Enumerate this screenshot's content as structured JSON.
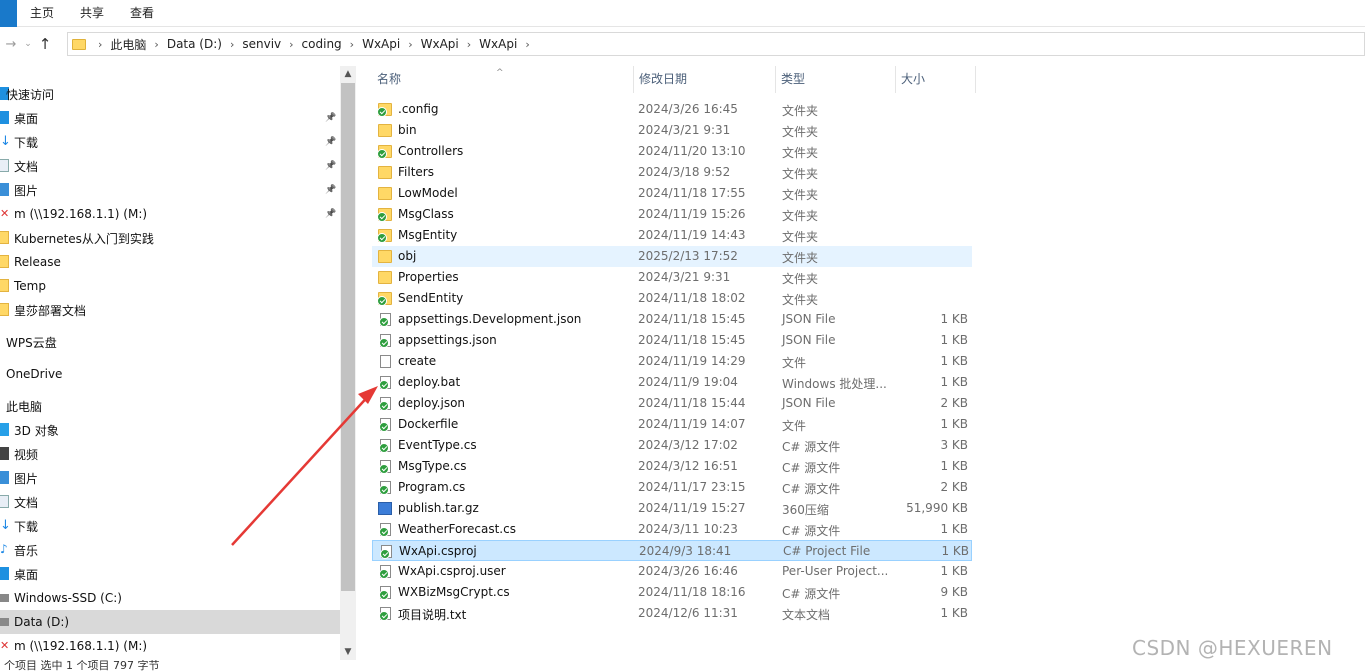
{
  "ribbon": {
    "tabs": [
      "主页",
      "共享",
      "查看"
    ]
  },
  "address": {
    "crumbs": [
      "此电脑",
      "Data (D:)",
      "senviv",
      "coding",
      "WxApi",
      "WxApi",
      "WxApi"
    ]
  },
  "sidebar": {
    "items": [
      {
        "label": "快速访问",
        "icon": "star-icon",
        "top": true
      },
      {
        "label": "桌面",
        "icon": "desktop-icon",
        "pin": true
      },
      {
        "label": "下载",
        "icon": "download-icon",
        "pin": true
      },
      {
        "label": "文档",
        "icon": "document-icon",
        "pin": true
      },
      {
        "label": "图片",
        "icon": "picture-icon",
        "pin": true
      },
      {
        "label": "m (\\\\192.168.1.1) (M:)",
        "icon": "network-drive-icon",
        "pin": true
      },
      {
        "label": "Kubernetes从入门到实践",
        "icon": "folder-icon"
      },
      {
        "label": "Release",
        "icon": "folder-icon"
      },
      {
        "label": "Temp",
        "icon": "folder-icon"
      },
      {
        "label": "皇莎部署文档",
        "icon": "folder-icon"
      },
      {
        "label": "WPS云盘",
        "icon": "cloud-icon",
        "top": true
      },
      {
        "label": "OneDrive",
        "icon": "onedrive-icon",
        "top": true
      },
      {
        "label": "此电脑",
        "icon": "pc-icon",
        "top": true
      },
      {
        "label": "3D 对象",
        "icon": "cube-icon"
      },
      {
        "label": "视频",
        "icon": "video-icon"
      },
      {
        "label": "图片",
        "icon": "picture-icon"
      },
      {
        "label": "文档",
        "icon": "document-icon"
      },
      {
        "label": "下载",
        "icon": "download-icon"
      },
      {
        "label": "音乐",
        "icon": "music-icon"
      },
      {
        "label": "桌面",
        "icon": "desktop-icon"
      },
      {
        "label": "Windows-SSD (C:)",
        "icon": "drive-icon"
      },
      {
        "label": "Data (D:)",
        "icon": "drive-icon",
        "state": "hover"
      },
      {
        "label": "m (\\\\192.168.1.1) (M:)",
        "icon": "network-drive-icon"
      }
    ]
  },
  "columns": {
    "name": "名称",
    "date": "修改日期",
    "type": "类型",
    "size": "大小"
  },
  "files": [
    {
      "name": ".config",
      "date": "2024/3/26 16:45",
      "type": "文件夹",
      "size": "",
      "kind": "folder",
      "sync": true
    },
    {
      "name": "bin",
      "date": "2024/3/21 9:31",
      "type": "文件夹",
      "size": "",
      "kind": "folder",
      "sync": false
    },
    {
      "name": "Controllers",
      "date": "2024/11/20 13:10",
      "type": "文件夹",
      "size": "",
      "kind": "folder",
      "sync": true
    },
    {
      "name": "Filters",
      "date": "2024/3/18 9:52",
      "type": "文件夹",
      "size": "",
      "kind": "folder",
      "sync": false
    },
    {
      "name": "LowModel",
      "date": "2024/11/18 17:55",
      "type": "文件夹",
      "size": "",
      "kind": "folder",
      "sync": false
    },
    {
      "name": "MsgClass",
      "date": "2024/11/19 15:26",
      "type": "文件夹",
      "size": "",
      "kind": "folder",
      "sync": true
    },
    {
      "name": "MsgEntity",
      "date": "2024/11/19 14:43",
      "type": "文件夹",
      "size": "",
      "kind": "folder",
      "sync": true
    },
    {
      "name": "obj",
      "date": "2025/2/13 17:52",
      "type": "文件夹",
      "size": "",
      "kind": "folder",
      "sync": false,
      "state": "hover"
    },
    {
      "name": "Properties",
      "date": "2024/3/21 9:31",
      "type": "文件夹",
      "size": "",
      "kind": "folder",
      "sync": false
    },
    {
      "name": "SendEntity",
      "date": "2024/11/18 18:02",
      "type": "文件夹",
      "size": "",
      "kind": "folder",
      "sync": true
    },
    {
      "name": "appsettings.Development.json",
      "date": "2024/11/18 15:45",
      "type": "JSON File",
      "size": "1 KB",
      "kind": "file",
      "sync": true
    },
    {
      "name": "appsettings.json",
      "date": "2024/11/18 15:45",
      "type": "JSON File",
      "size": "1 KB",
      "kind": "file",
      "sync": true
    },
    {
      "name": "create",
      "date": "2024/11/19 14:29",
      "type": "文件",
      "size": "1 KB",
      "kind": "file",
      "sync": false
    },
    {
      "name": "deploy.bat",
      "date": "2024/11/9 19:04",
      "type": "Windows 批处理...",
      "size": "1 KB",
      "kind": "file",
      "sync": true
    },
    {
      "name": "deploy.json",
      "date": "2024/11/18 15:44",
      "type": "JSON File",
      "size": "2 KB",
      "kind": "file",
      "sync": true
    },
    {
      "name": "Dockerfile",
      "date": "2024/11/19 14:07",
      "type": "文件",
      "size": "1 KB",
      "kind": "file",
      "sync": true
    },
    {
      "name": "EventType.cs",
      "date": "2024/3/12 17:02",
      "type": "C# 源文件",
      "size": "3 KB",
      "kind": "file",
      "sync": true
    },
    {
      "name": "MsgType.cs",
      "date": "2024/3/12 16:51",
      "type": "C# 源文件",
      "size": "1 KB",
      "kind": "file",
      "sync": true
    },
    {
      "name": "Program.cs",
      "date": "2024/11/17 23:15",
      "type": "C# 源文件",
      "size": "2 KB",
      "kind": "file",
      "sync": true
    },
    {
      "name": "publish.tar.gz",
      "date": "2024/11/19 15:27",
      "type": "360压缩",
      "size": "51,990 KB",
      "kind": "archive",
      "sync": false
    },
    {
      "name": "WeatherForecast.cs",
      "date": "2024/3/11 10:23",
      "type": "C# 源文件",
      "size": "1 KB",
      "kind": "file",
      "sync": true
    },
    {
      "name": "WxApi.csproj",
      "date": "2024/9/3 18:41",
      "type": "C# Project File",
      "size": "1 KB",
      "kind": "file",
      "sync": true,
      "state": "selected"
    },
    {
      "name": "WxApi.csproj.user",
      "date": "2024/3/26 16:46",
      "type": "Per-User Project...",
      "size": "1 KB",
      "kind": "file",
      "sync": true
    },
    {
      "name": "WXBizMsgCrypt.cs",
      "date": "2024/11/18 18:16",
      "type": "C# 源文件",
      "size": "9 KB",
      "kind": "file",
      "sync": true
    },
    {
      "name": "项目说明.txt",
      "date": "2024/12/6 11:31",
      "type": "文本文档",
      "size": "1 KB",
      "kind": "file",
      "sync": true
    }
  ],
  "status": {
    "text": "个项目    选中 1 个项目  797 字节"
  },
  "watermark": "CSDN @HEXUEREN",
  "colors": {
    "selection": "#cce8ff",
    "hover": "#e5f3ff",
    "accent": "#1979ca",
    "annotation_arrow": "#e53935"
  }
}
